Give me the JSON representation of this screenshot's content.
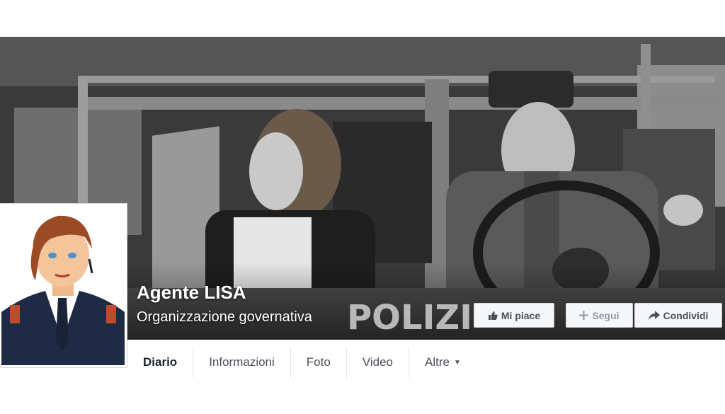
{
  "page": {
    "name": "Agente LISA",
    "category": "Organizzazione governativa",
    "cover_text": "POLIZI"
  },
  "actions": {
    "like_label": "Mi piace",
    "follow_label": "Segui",
    "share_label": "Condividi"
  },
  "tabs": [
    {
      "label": "Diario",
      "active": true
    },
    {
      "label": "Informazioni",
      "active": false
    },
    {
      "label": "Foto",
      "active": false
    },
    {
      "label": "Video",
      "active": false
    },
    {
      "label": "Altre",
      "active": false
    }
  ],
  "colors": {
    "button_bg": "#f6f7f9",
    "button_border": "#ced0d4",
    "button_text": "#4b4f56",
    "tab_text": "#4b4f56"
  },
  "icons": {
    "like": "thumbs-up-icon",
    "follow": "plus-icon",
    "share": "share-arrow-icon",
    "more": "caret-down-icon"
  }
}
